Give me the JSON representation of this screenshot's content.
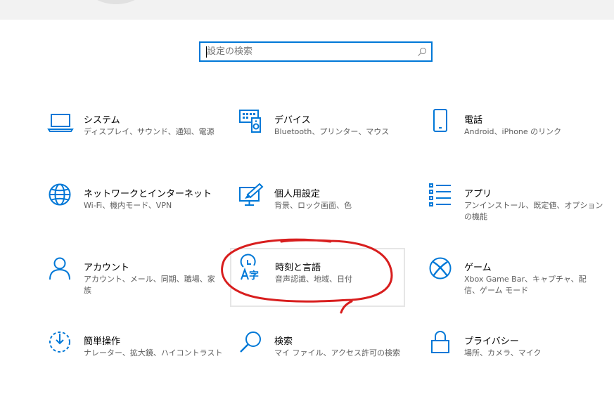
{
  "search": {
    "placeholder": "設定の検索",
    "icon": "search-icon"
  },
  "accent_color": "#0078d7",
  "annotation_color": "#d81e1e",
  "tiles": [
    {
      "title": "システム",
      "desc": "ディスプレイ、サウンド、通知、電源",
      "icon": "laptop-icon"
    },
    {
      "title": "デバイス",
      "desc": "Bluetooth、プリンター、マウス",
      "icon": "keyboard-speaker-icon"
    },
    {
      "title": "電話",
      "desc": "Android、iPhone のリンク",
      "icon": "phone-icon"
    },
    {
      "title": "ネットワークとインターネット",
      "desc": "Wi-Fi、機内モード、VPN",
      "icon": "globe-icon"
    },
    {
      "title": "個人用設定",
      "desc": "背景、ロック画面、色",
      "icon": "monitor-brush-icon"
    },
    {
      "title": "アプリ",
      "desc": "アンインストール、既定値、オプション\nの機能",
      "icon": "app-list-icon"
    },
    {
      "title": "アカウント",
      "desc": "アカウント、メール、同期、職場、家\n族",
      "icon": "person-icon"
    },
    {
      "title": "時刻と言語",
      "desc": "音声認識、地域、日付",
      "icon": "time-language-icon"
    },
    {
      "title": "ゲーム",
      "desc": "Xbox Game Bar、キャプチャ、配\n信、ゲーム モード",
      "icon": "xbox-icon"
    },
    {
      "title": "簡単操作",
      "desc": "ナレーター、拡大鏡、ハイコントラスト",
      "icon": "ease-of-access-icon"
    },
    {
      "title": "検索",
      "desc": "マイ ファイル、アクセス許可の検索",
      "icon": "magnifier-icon"
    },
    {
      "title": "プライバシー",
      "desc": "場所、カメラ、マイク",
      "icon": "lock-icon"
    }
  ]
}
